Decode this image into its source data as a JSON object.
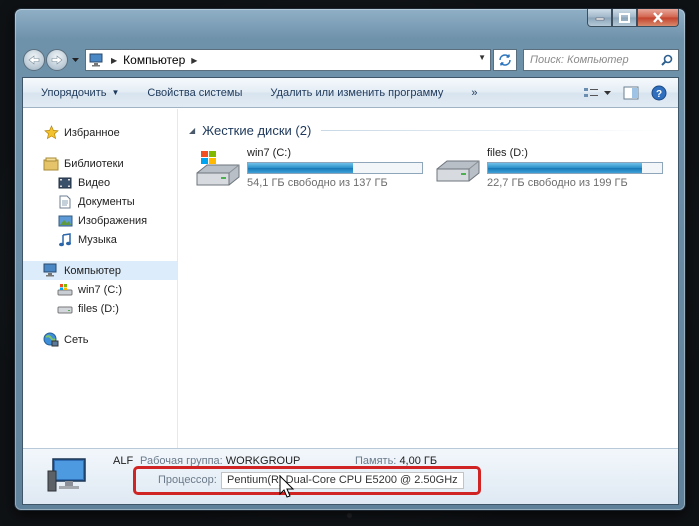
{
  "address": {
    "breadcrumb": "Компьютер",
    "search_placeholder": "Поиск: Компьютер"
  },
  "toolbar": {
    "organize": "Упорядочить",
    "system_properties": "Свойства системы",
    "uninstall": "Удалить или изменить программу",
    "more": "»"
  },
  "nav": {
    "favorites": "Избранное",
    "libraries": "Библиотеки",
    "video": "Видео",
    "documents": "Документы",
    "pictures": "Изображения",
    "music": "Музыка",
    "computer": "Компьютер",
    "drive_c": "win7 (C:)",
    "drive_d": "files (D:)",
    "network": "Сеть"
  },
  "content": {
    "group_title": "Жесткие диски (2)",
    "drives": [
      {
        "name": "win7 (C:)",
        "free_text": "54,1 ГБ свободно из 137 ГБ",
        "used_fraction": 0.605
      },
      {
        "name": "files (D:)",
        "free_text": "22,7 ГБ свободно из 199 ГБ",
        "used_fraction": 0.886
      }
    ]
  },
  "details": {
    "computer_name": "ALF",
    "workgroup_label": "Рабочая группа:",
    "workgroup_value": "WORKGROUP",
    "memory_label": "Память:",
    "memory_value": "4,00 ГБ",
    "processor_label": "Процессор:",
    "processor_value": "Pentium(R) Dual-Core  CPU      E5200  @ 2.50GHz"
  },
  "colors": {
    "highlight": "#d02323",
    "drive_fill": "#1f86c2"
  }
}
